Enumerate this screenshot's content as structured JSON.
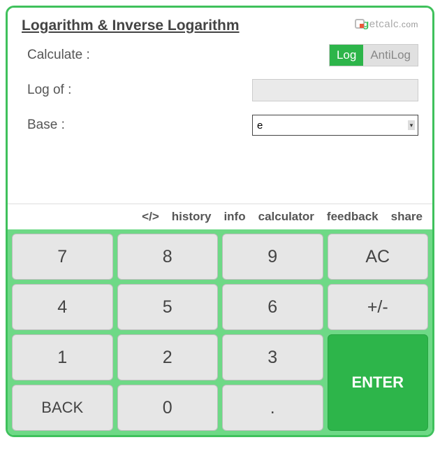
{
  "title": "Logarithm & Inverse Logarithm",
  "brand": {
    "prefix": "etcalc",
    "suffix": ".com"
  },
  "form": {
    "calculate_label": "Calculate :",
    "toggle": {
      "log": "Log",
      "antilog": "AntiLog"
    },
    "logof_label": "Log of :",
    "logof_value": "",
    "base_label": "Base :",
    "base_value": "e"
  },
  "actions": {
    "embed": "</>",
    "history": "history",
    "info": "info",
    "calculator": "calculator",
    "feedback": "feedback",
    "share": "share"
  },
  "keys": {
    "k7": "7",
    "k8": "8",
    "k9": "9",
    "ac": "AC",
    "k4": "4",
    "k5": "5",
    "k6": "6",
    "pm": "+/-",
    "k1": "1",
    "k2": "2",
    "k3": "3",
    "enter": "ENTER",
    "back": "BACK",
    "k0": "0",
    "dot": "."
  }
}
